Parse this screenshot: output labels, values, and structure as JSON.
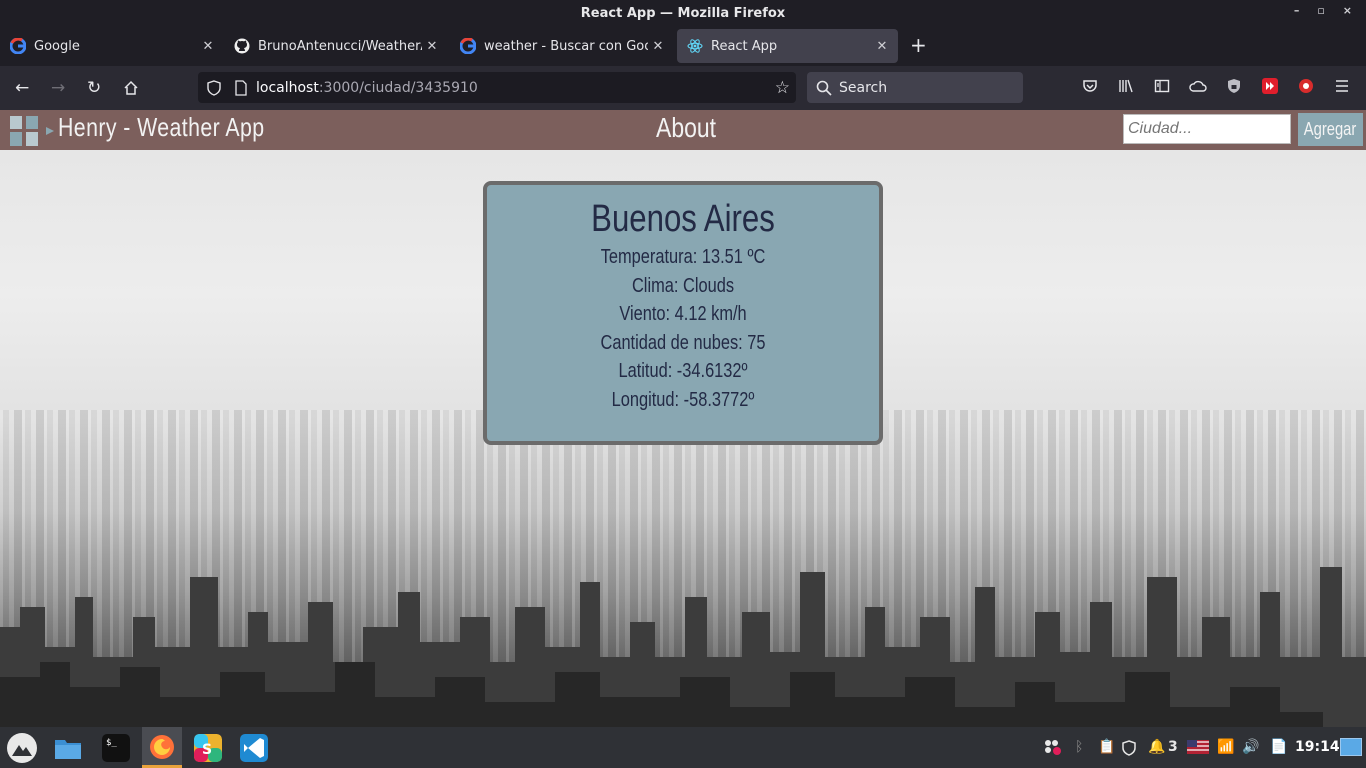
{
  "window": {
    "title": "React App — Mozilla Firefox",
    "controls": [
      "–",
      "▫",
      "×"
    ]
  },
  "tabs": [
    {
      "label": "Google",
      "icon": "google-icon"
    },
    {
      "label": "BrunoAntenucci/WeatherApp",
      "icon": "github-icon"
    },
    {
      "label": "weather - Buscar con Google",
      "icon": "google-icon"
    },
    {
      "label": "React App",
      "icon": "react-icon",
      "active": true
    }
  ],
  "navbar": {
    "url_host": "localhost",
    "url_path": ":3000/ciudad/3435910",
    "search_placeholder": "Search"
  },
  "app": {
    "brand": "Henry - Weather App",
    "nav_about": "About",
    "city_placeholder": "Ciudad...",
    "add_button": "Agregar",
    "accent_colors": {
      "nav": "#7c5f5c",
      "card": "#89a7b2",
      "button": "#8aa7b1",
      "text": "#232a45"
    }
  },
  "city_card": {
    "name": "Buenos Aires",
    "rows": [
      "Temperatura: 13.51 ºC",
      "Clima: Clouds",
      "Viento: 4.12 km/h",
      "Cantidad de nubes: 75",
      "Latitud: -34.6132º",
      "Longitud: -58.3772º"
    ]
  },
  "taskbar": {
    "clock": "19:14",
    "notification_count": "3",
    "apps": [
      "menu-icon",
      "files-icon",
      "terminal-icon",
      "firefox-icon",
      "slack-icon",
      "vscode-icon"
    ]
  }
}
